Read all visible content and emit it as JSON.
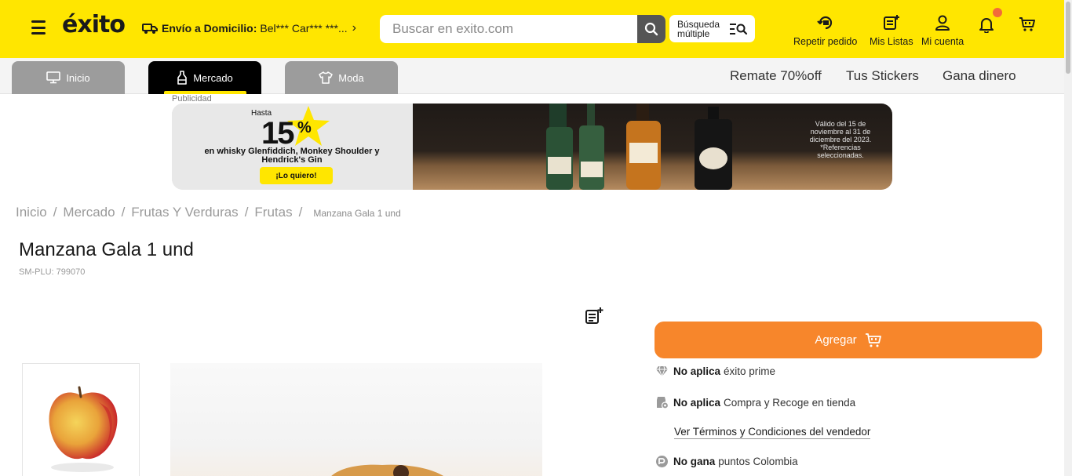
{
  "header": {
    "logo": "éxito",
    "delivery_label": "Envío a Domicilio:",
    "delivery_value": "Bel*** Car*** ***...",
    "search_placeholder": "Buscar en exito.com",
    "multi_search_label": "Búsqueda múltiple",
    "actions": [
      {
        "label": "Repetir pedido",
        "icon": "repeat-order-icon"
      },
      {
        "label": "Mis Listas",
        "icon": "list-icon"
      },
      {
        "label": "Mi cuenta",
        "icon": "user-icon"
      }
    ],
    "colors": {
      "brand_yellow": "#ffe600",
      "notification_dot": "#f26b3a"
    }
  },
  "subnav": {
    "tabs": [
      {
        "label": "Inicio",
        "icon": "monitor-icon",
        "active": false
      },
      {
        "label": "Mercado",
        "icon": "bottle-icon",
        "active": true
      },
      {
        "label": "Moda",
        "icon": "shirt-icon",
        "active": false
      }
    ],
    "links": [
      "Remate 70%off",
      "Tus Stickers",
      "Gana dinero"
    ]
  },
  "banner": {
    "ad_label": "Publicidad",
    "hasta": "Hasta",
    "discount_number": "15",
    "discount_symbol": "%",
    "description": "en whisky Glenfiddich, Monkey Shoulder y Hendrick's Gin",
    "cta": "¡Lo quiero!",
    "legal": "Válido del 15 de noviembre al 31 de diciembre del 2023. *Referencias seleccionadas."
  },
  "breadcrumb": {
    "items": [
      "Inicio",
      "Mercado",
      "Frutas Y Verduras",
      "Frutas"
    ],
    "current": "Manzana Gala 1 und",
    "separator": "/"
  },
  "product": {
    "title": "Manzana Gala 1 und",
    "sku": "SM-PLU: 799070",
    "add_button": "Agregar",
    "add_button_color": "#f7862b",
    "prime_bold": "No aplica",
    "prime_text": "éxito prime",
    "pickup_bold": "No aplica",
    "pickup_text": "Compra y Recoge en tienda",
    "terms_link": "Ver Términos y Condiciones del vendedor",
    "points_bold": "No gana",
    "points_text": "puntos Colombia"
  }
}
